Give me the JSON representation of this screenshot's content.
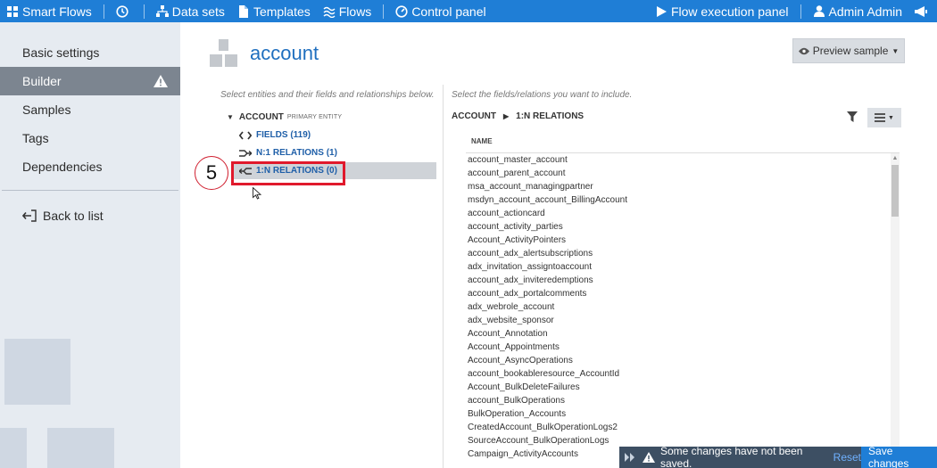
{
  "topbar": {
    "brand": "Smart Flows",
    "datasets": "Data sets",
    "templates": "Templates",
    "flows": "Flows",
    "control_panel": "Control panel",
    "flow_execution": "Flow execution panel",
    "user": "Admin Admin",
    "bg_color": "#1f7ed6"
  },
  "sidebar": {
    "items": [
      {
        "label": "Basic settings"
      },
      {
        "label": "Builder",
        "active": true,
        "icon": "warning-icon"
      },
      {
        "label": "Samples"
      },
      {
        "label": "Tags"
      },
      {
        "label": "Dependencies"
      }
    ],
    "back_label": "Back to list"
  },
  "main": {
    "title": "account",
    "preview_label": "Preview sample",
    "left_hint": "Select entities and their fields and relationships below.",
    "right_hint": "Select the fields/relations you want to include.",
    "step_number": "5"
  },
  "tree": {
    "root_label": "ACCOUNT",
    "root_badge": "PRIMARY ENTITY",
    "fields_label": "FIELDS (119)",
    "n1_label": "N:1 RELATIONS (1)",
    "onen_label": "1:N RELATIONS (0)"
  },
  "right": {
    "crumb_entity": "ACCOUNT",
    "crumb_section": "1:N RELATIONS",
    "column_header": "NAME",
    "rows": [
      "account_master_account",
      "account_parent_account",
      "msa_account_managingpartner",
      "msdyn_account_account_BillingAccount",
      "account_actioncard",
      "account_activity_parties",
      "Account_ActivityPointers",
      "account_adx_alertsubscriptions",
      "adx_invitation_assigntoaccount",
      "account_adx_inviteredemptions",
      "account_adx_portalcomments",
      "adx_webrole_account",
      "adx_website_sponsor",
      "Account_Annotation",
      "Account_Appointments",
      "Account_AsyncOperations",
      "account_bookableresource_AccountId",
      "Account_BulkDeleteFailures",
      "account_BulkOperations",
      "BulkOperation_Accounts",
      "CreatedAccount_BulkOperationLogs2",
      "SourceAccount_BulkOperationLogs",
      "Campaign_ActivityAccounts"
    ]
  },
  "notification": {
    "message": "Some changes have not been saved.",
    "reset": "Reset",
    "save": "Save changes"
  }
}
